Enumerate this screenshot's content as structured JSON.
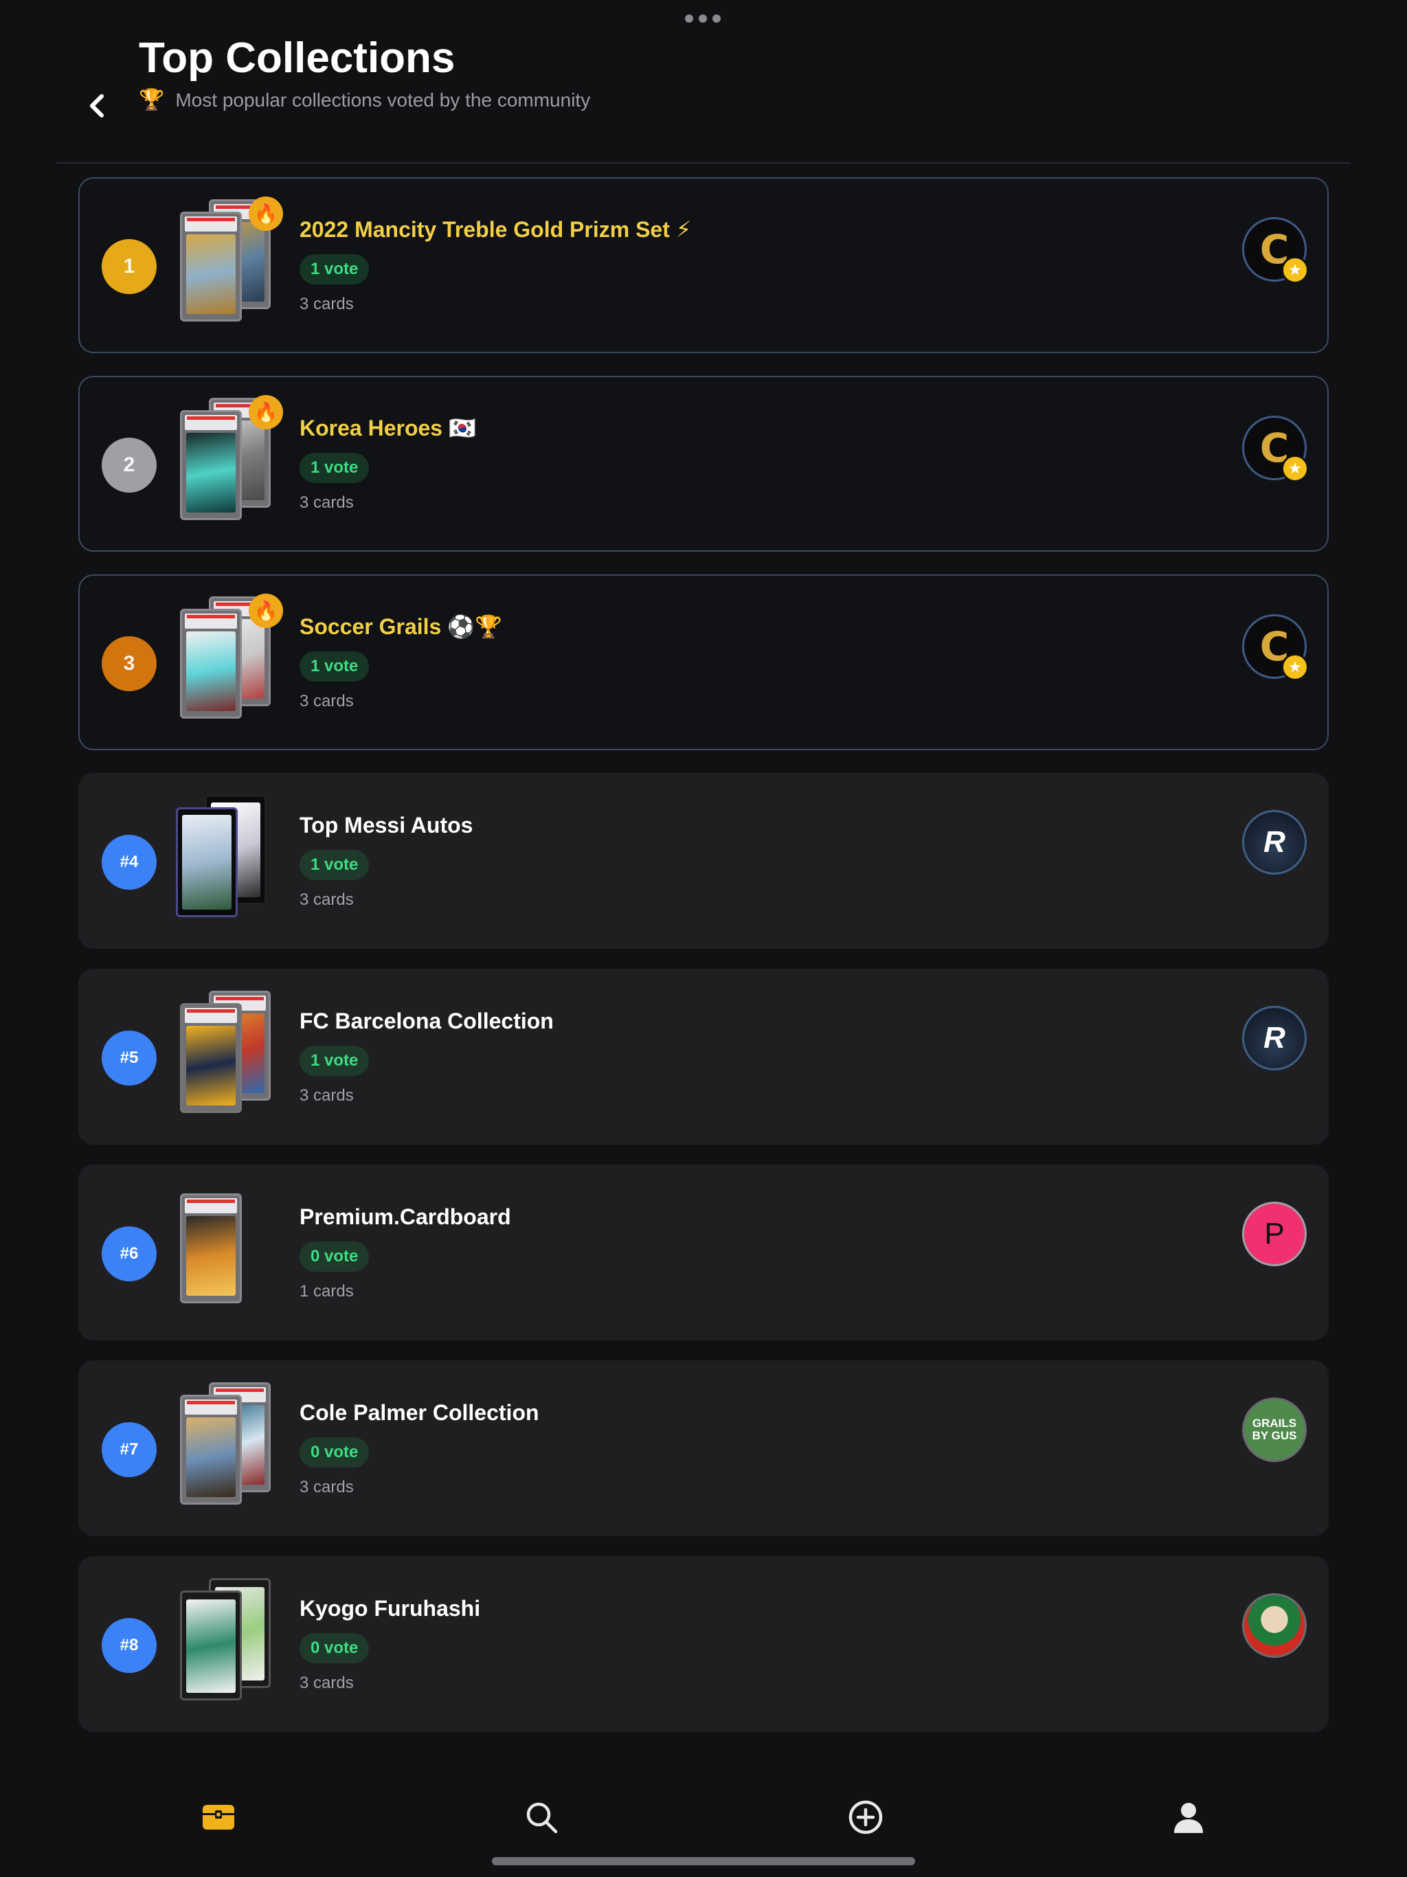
{
  "header": {
    "title": "Top Collections",
    "subtitle_emoji": "🏆",
    "subtitle": "Most popular collections voted by the community"
  },
  "collections": [
    {
      "rank_label": "",
      "medal": "1",
      "name": "2022 Mancity Treble Gold Prizm Set ⚡",
      "votes": "1 vote",
      "cards": "3 cards",
      "owner_avatar": "c-logo-icon"
    },
    {
      "rank_label": "",
      "medal": "2",
      "name": "Korea Heroes 🇰🇷",
      "votes": "1 vote",
      "cards": "3 cards",
      "owner_avatar": "c-logo-icon"
    },
    {
      "rank_label": "",
      "medal": "3",
      "name": "Soccer Grails ⚽🏆",
      "votes": "1 vote",
      "cards": "3 cards",
      "owner_avatar": "c-logo-icon"
    },
    {
      "rank_label": "#4",
      "name": "Top Messi Autos",
      "votes": "1 vote",
      "cards": "3 cards",
      "owner_avatar": "r-logo-icon"
    },
    {
      "rank_label": "#5",
      "name": "FC Barcelona Collection",
      "votes": "1 vote",
      "cards": "3 cards",
      "owner_avatar": "r-logo-icon"
    },
    {
      "rank_label": "#6",
      "name": "Premium.Cardboard",
      "votes": "0 vote",
      "cards": "1 cards",
      "owner_avatar": "P"
    },
    {
      "rank_label": "#7",
      "name": "Cole Palmer Collection",
      "votes": "0 vote",
      "cards": "3 cards",
      "owner_avatar": "GRAILS BY GUS"
    },
    {
      "rank_label": "#8",
      "name": "Kyogo Furuhashi",
      "votes": "0 vote",
      "cards": "3 cards",
      "owner_avatar": "player-photo-icon"
    }
  ],
  "avatars": {
    "c_letter": "C",
    "r_letter": "R",
    "p_letter": "P",
    "g_line1": "GRAILS",
    "g_line2": "BY GUS"
  },
  "tabs": [
    "collections-tab-icon",
    "search-tab-icon",
    "add-tab-icon",
    "profile-tab-icon"
  ],
  "colors": {
    "accent_gold": "#f3cf45",
    "vote_green": "#3ddc84",
    "rank_blue": "#3b82f6",
    "tab_active": "#f0b21b"
  }
}
